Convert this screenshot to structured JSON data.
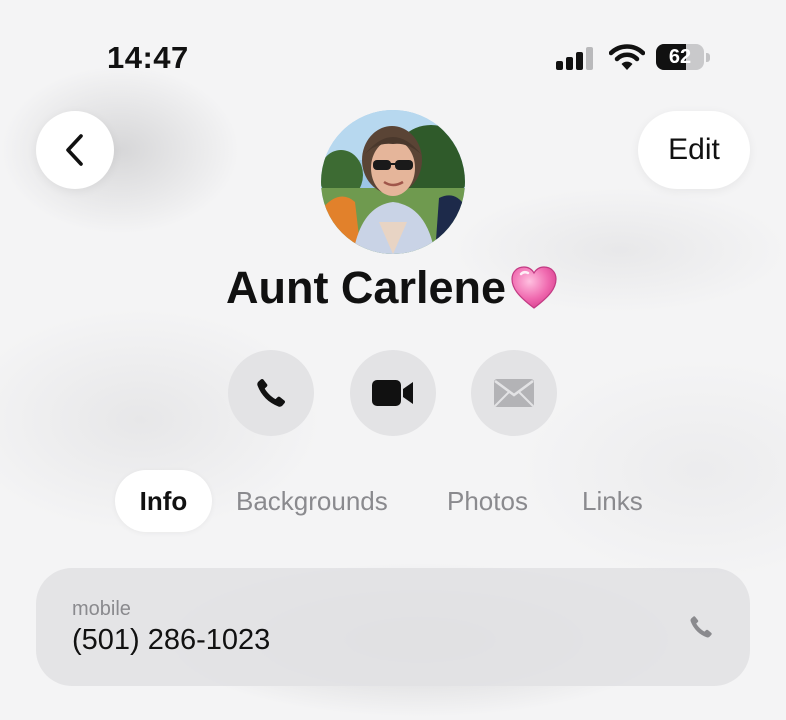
{
  "status_bar": {
    "time": "14:47",
    "battery_percent": "62",
    "signal_icon": "cellular-signal-icon",
    "wifi_icon": "wifi-icon"
  },
  "header": {
    "back_icon": "chevron-left-icon",
    "edit_label": "Edit"
  },
  "contact": {
    "name": "Aunt Carlene",
    "name_emoji": "pink-heart-emoji"
  },
  "actions": [
    {
      "name": "call",
      "icon": "phone-icon"
    },
    {
      "name": "video",
      "icon": "video-camera-icon"
    },
    {
      "name": "mail",
      "icon": "envelope-icon"
    }
  ],
  "tabs": [
    {
      "label": "Info",
      "active": true
    },
    {
      "label": "Backgrounds",
      "active": false
    },
    {
      "label": "Photos",
      "active": false
    },
    {
      "label": "Links",
      "active": false
    }
  ],
  "info": {
    "phone_label": "mobile",
    "phone_number": "(501) 286-1023"
  },
  "colors": {
    "background": "#f4f4f5",
    "button_bg": "#ffffff",
    "action_bg": "#e3e3e5",
    "text_primary": "#111111",
    "text_secondary": "#8a8a8e",
    "heart": "#f06bb0"
  }
}
